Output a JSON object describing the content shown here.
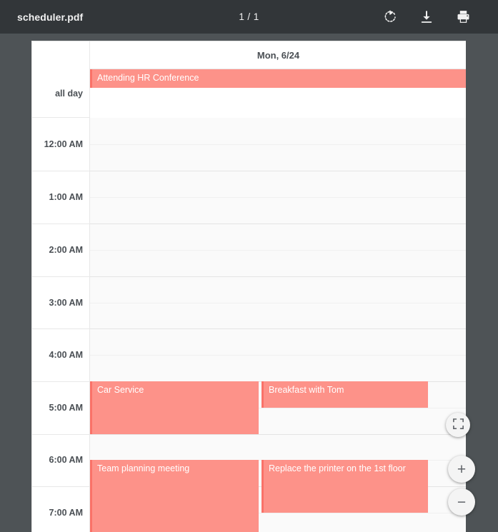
{
  "toolbar": {
    "document_title": "scheduler.pdf",
    "page_indicator": "1 / 1",
    "rotate_icon": "rotate-clockwise-icon",
    "download_icon": "download-icon",
    "print_icon": "print-icon",
    "background_color": "#323639"
  },
  "viewer": {
    "background_color": "#4e5356",
    "zoom_controls": {
      "fit_label": "fit-to-page",
      "zoom_in_label": "+",
      "zoom_out_label": "−"
    }
  },
  "calendar": {
    "day_header": "Mon, 6/24",
    "all_day_label": "all day",
    "event_fill_color": "#fd9289",
    "event_border_color": "#fa7268",
    "grid_background": "#fafafa",
    "hours": [
      {
        "label": "12:00 AM"
      },
      {
        "label": "1:00 AM"
      },
      {
        "label": "2:00 AM"
      },
      {
        "label": "3:00 AM"
      },
      {
        "label": "4:00 AM"
      },
      {
        "label": "5:00 AM"
      },
      {
        "label": "6:00 AM"
      },
      {
        "label": "7:00 AM"
      }
    ],
    "all_day_events": [
      {
        "title": "Attending HR Conference"
      }
    ],
    "events": [
      {
        "title": "Car Service"
      },
      {
        "title": "Breakfast with Tom"
      },
      {
        "title": "Team planning meeting"
      },
      {
        "title": "Replace the printer on the 1st floor"
      }
    ]
  }
}
